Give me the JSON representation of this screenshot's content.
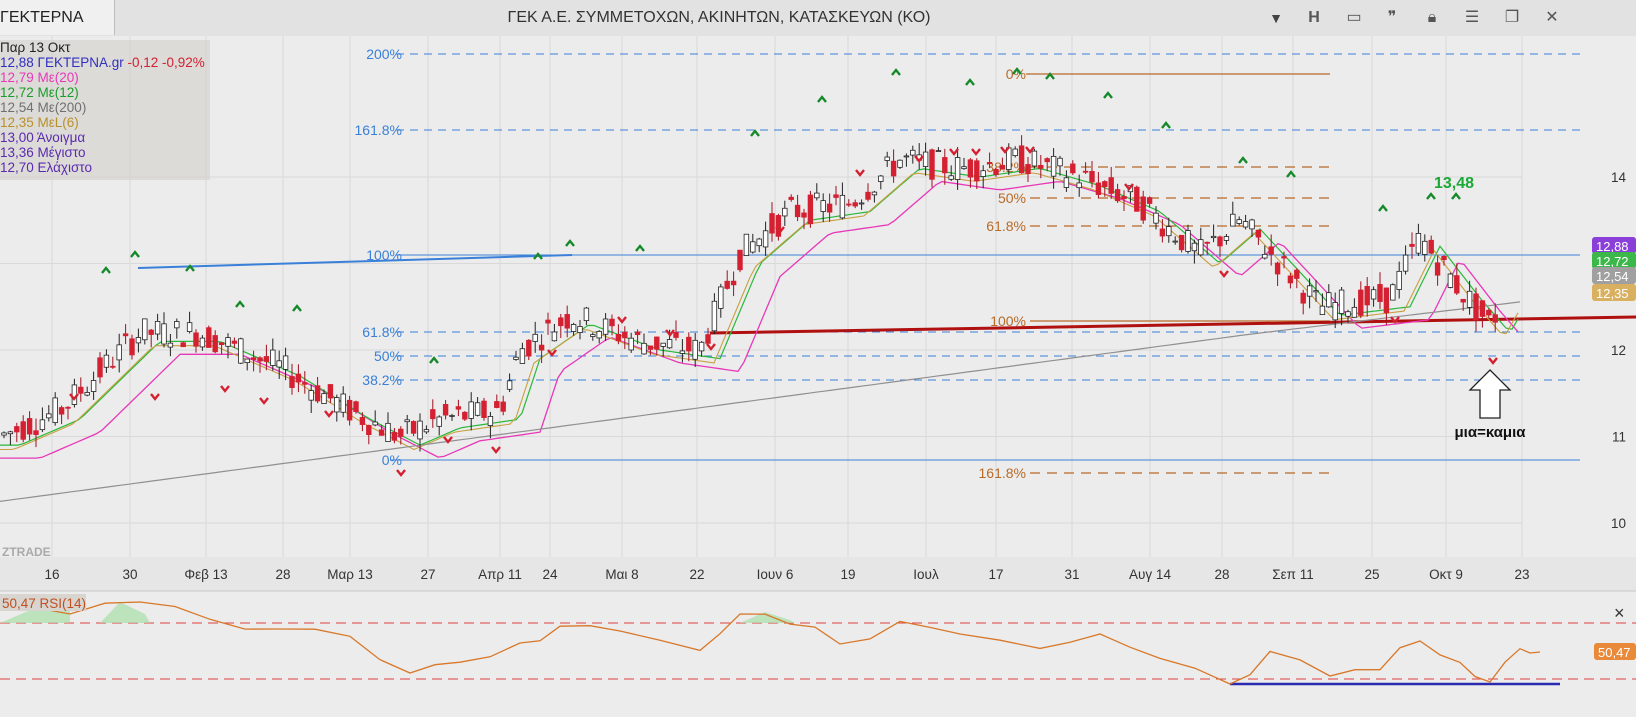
{
  "topbar": {
    "ticker": "ΓΕΚΤΕΡΝΑ",
    "title": "ΓΕΚ  Α.Ε. ΣΥΜΜΕΤΟΧΩΝ, ΑΚΙΝΗΤΩΝ, ΚΑΤΑΣΚΕΥΩΝ (ΚΟ)",
    "dropdown_icon": "chevron-down-icon",
    "h_label": "H",
    "icons": [
      "panel-icon",
      "quote-icon",
      "lock-icon",
      "menu-icon",
      "restore-window-icon",
      "close-icon"
    ]
  },
  "legend": {
    "date": "Παρ 13 Οκτ",
    "price": "12,88 ΓΕΚΤΕΡΝΑ.gr",
    "change": "-0,12 -0,92%",
    "ma20": "12,79 Με(20)",
    "ma12": "12,72 Με(12)",
    "ma200": "12,54 Με(200)",
    "mal6": "12,35 ΜεL(6)",
    "open": "13,00 Άνοιγμα",
    "high": "13,36 Μέγιστο",
    "low": "12,70 Ελάχιστο"
  },
  "colors": {
    "price_up": "#ffffff",
    "price_down": "#d42030",
    "ma20": "#e838b8",
    "ma12": "#2ab83a",
    "ma200": "#909090",
    "mal6": "#c8a040",
    "fib_blue": "#3a80d8",
    "fib_brown": "#b86a28",
    "support": "#b01010",
    "rsi": "#d8782a"
  },
  "watermark": "ZTRADE",
  "x_ticks": [
    "16",
    "30",
    "Φεβ 13",
    "28",
    "Μαρ 13",
    "27",
    "Απρ 11",
    "24",
    "Μαι 8",
    "22",
    "Ιουν 6",
    "19",
    "Ιουλ",
    "17",
    "31",
    "Αυγ 14",
    "28",
    "Σεπ 11",
    "25",
    "Οκτ 9",
    "23"
  ],
  "y_ticks": [
    "14",
    "13",
    "12",
    "11",
    "10"
  ],
  "price_badges": [
    "12,88",
    "12,72",
    "12,54",
    "12,35"
  ],
  "fib_blue_labels": [
    "200%",
    "161.8%",
    "100%",
    "61.8%",
    "50%",
    "38.2%",
    "0%"
  ],
  "fib_brown_labels": [
    "0%",
    "38.2%",
    "50%",
    "61.8%",
    "100%",
    "161.8%"
  ],
  "annotation_high": "13,48",
  "annotation_note": "μια=καμια",
  "rsi": {
    "label": "50,47 RSI(14)",
    "value_badge": "50,47",
    "close_symbol": "×"
  },
  "chart_data": {
    "type": "candlestick",
    "series": [
      {
        "name": "Με(20)",
        "value": 12.79
      },
      {
        "name": "Με(12)",
        "value": 12.72
      },
      {
        "name": "Με(200)",
        "value": 12.54
      },
      {
        "name": "ΜεL(6)",
        "value": 12.35
      }
    ],
    "last": {
      "open": 13.0,
      "high": 13.36,
      "low": 12.7,
      "close": 12.88
    },
    "ylim": [
      9.8,
      14.6
    ]
  }
}
